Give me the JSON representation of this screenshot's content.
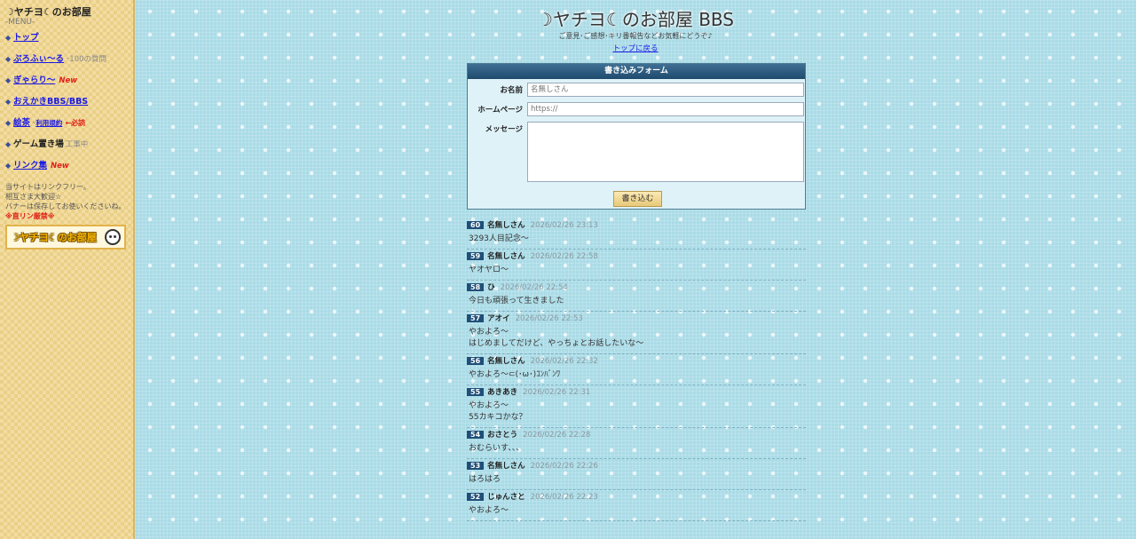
{
  "sidebar": {
    "site_title": "☽ヤチヨ☾のお部屋",
    "menu_label": "-MENU-",
    "items": [
      {
        "label": "トップ",
        "link": true
      },
      {
        "label": "ぷろふぃ～る",
        "link": true,
        "note": "･100の質問"
      },
      {
        "label": "ぎゃらり～",
        "link": true,
        "badge": "New"
      },
      {
        "label": "おえかきBBS/BBS",
        "link": true
      },
      {
        "label": "絵茶",
        "link": true,
        "sep": "･",
        "sublink": "利用規約",
        "required": "←必読"
      },
      {
        "label": "ゲーム置き場",
        "link": false,
        "note": "工事中"
      },
      {
        "label": "リンク集",
        "link": true,
        "badge": "New"
      }
    ],
    "info_lines": [
      "当サイトはリンクフリー。",
      "相互さま大歓迎☆",
      "バナーは保存してお使いくださいね。"
    ],
    "info_warning": "※直リン厳禁※",
    "banner_text": "☽ヤチヨ☾のお部屋"
  },
  "header": {
    "title": "☽ヤチヨ☾のお部屋 BBS",
    "subtitle": "ご意見･ご感想･キリ番報告などお気軽にどうぞ♪",
    "top_link": "トップに戻る"
  },
  "form": {
    "heading": "書き込みフォーム",
    "name_label": "お名前",
    "name_placeholder": "名無しさん",
    "homepage_label": "ホームページ",
    "homepage_placeholder": "https://",
    "message_label": "メッセージ",
    "submit_label": "書き込む"
  },
  "posts": [
    {
      "num": "60",
      "name": "名無しさん",
      "time": "2026/02/26 23:13",
      "lines": [
        "3293人目記念～"
      ]
    },
    {
      "num": "59",
      "name": "名無しさん",
      "time": "2026/02/26 22:58",
      "lines": [
        "ヤオヤロ～"
      ]
    },
    {
      "num": "58",
      "name": "ひ",
      "time": "2026/02/26 22:54",
      "lines": [
        "今日も頑張って生きました"
      ]
    },
    {
      "num": "57",
      "name": "アオイ",
      "time": "2026/02/26 22:53",
      "lines": [
        "やおよろ～",
        "はじめましてだけど、やっちょとお話したいな～"
      ]
    },
    {
      "num": "56",
      "name": "名無しさん",
      "time": "2026/02/26 22:32",
      "lines": [
        "やおよろ～⊂(･ω･)ｺﾝﾊﾞﾝﾜ"
      ]
    },
    {
      "num": "55",
      "name": "あきあき",
      "time": "2026/02/26 22:31",
      "lines": [
        "やおよろ～",
        "55カキコかな？"
      ]
    },
    {
      "num": "54",
      "name": "おさとう",
      "time": "2026/02/26 22:28",
      "lines": [
        "おむらいす、、、"
      ]
    },
    {
      "num": "53",
      "name": "名無しさん",
      "time": "2026/02/26 22:26",
      "lines": [
        "はろはろ"
      ]
    },
    {
      "num": "52",
      "name": "じゅんさと",
      "time": "2026/02/26 22:23",
      "lines": [
        "やおよろ～"
      ]
    }
  ]
}
